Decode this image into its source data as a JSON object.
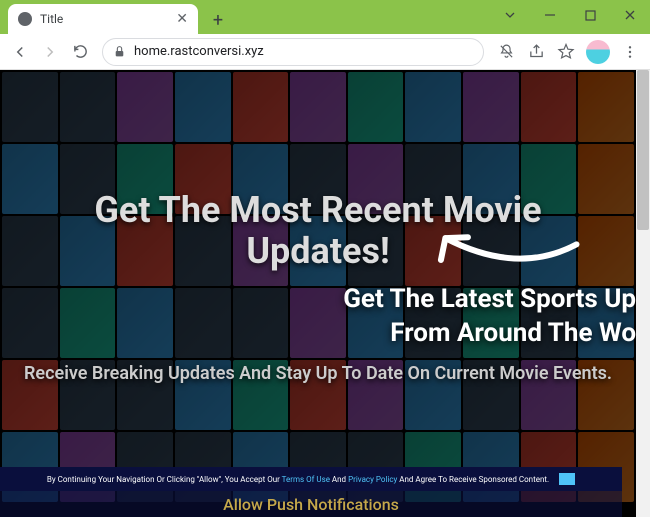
{
  "tab": {
    "title": "Title"
  },
  "url": "home.rastconversi.xyz",
  "page": {
    "hero1": "Get The Most Recent Movie Updates!",
    "hero2_line1": "Get The Latest Sports Up",
    "hero2_line2": "From Around The Wo",
    "hero3": "Receive Breaking Updates And Stay Up To Date On Current Movie Events.",
    "consent_prefix": "By Continuing Your Navigation Or Clicking \"Allow\", You Accept Our ",
    "consent_terms": "Terms Of Use",
    "consent_and": " And ",
    "consent_privacy": "Privacy Policy",
    "consent_suffix": " And Agree To Receive Sponsored Content.",
    "push_title": "Allow Push Notifications"
  }
}
